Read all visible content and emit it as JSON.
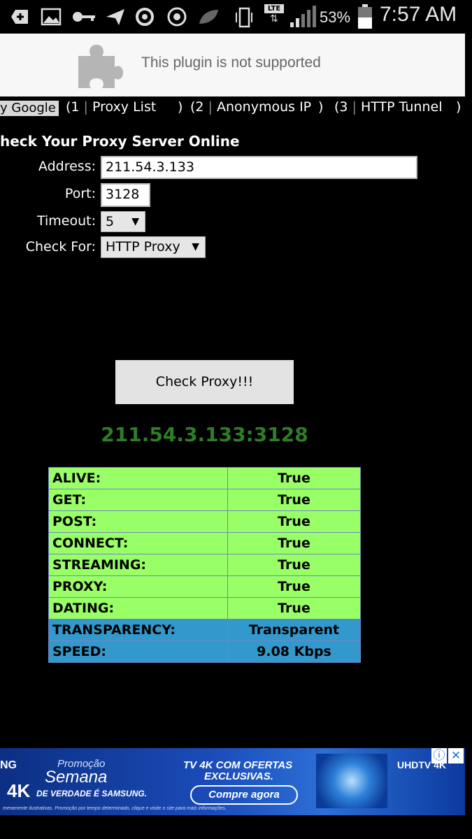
{
  "status_bar": {
    "icons": [
      "add-icon",
      "image-icon",
      "key-icon",
      "send-icon",
      "sync-icon",
      "chrome-icon",
      "leaf-icon",
      "vibrate-icon",
      "lte-icon",
      "signal-icon",
      "battery-icon"
    ],
    "network": "LTE",
    "battery": "53%",
    "time": "7:57 AM"
  },
  "plugin": {
    "message": "This plugin is not supported"
  },
  "tabs": {
    "google": "y Google",
    "items": [
      {
        "num": "1",
        "label": "Proxy List"
      },
      {
        "num": "2",
        "label": "Anonymous IP"
      },
      {
        "num": "3",
        "label": "HTTP Tunnel"
      }
    ]
  },
  "form": {
    "title": "heck Your Proxy Server Online",
    "address_label": "Address:",
    "address_value": "211.54.3.133",
    "port_label": "Port:",
    "port_value": "3128",
    "timeout_label": "Timeout:",
    "timeout_value": "5",
    "checkfor_label": "Check For:",
    "checkfor_value": "HTTP Proxy",
    "button": "Check Proxy!!!"
  },
  "result": {
    "ip": "211.54.3.133:3128",
    "rows": [
      {
        "key": "ALIVE:",
        "value": "True",
        "color": "#99ff66"
      },
      {
        "key": "GET:",
        "value": "True",
        "color": "#99ff66"
      },
      {
        "key": "POST:",
        "value": "True",
        "color": "#99ff66"
      },
      {
        "key": "CONNECT:",
        "value": "True",
        "color": "#99ff66"
      },
      {
        "key": "STREAMING:",
        "value": "True",
        "color": "#99ff66"
      },
      {
        "key": "PROXY:",
        "value": "True",
        "color": "#99ff66"
      },
      {
        "key": "DATING:",
        "value": "True",
        "color": "#99ff66"
      },
      {
        "key": "TRANSPARENCY:",
        "value": "Transparent",
        "color": "#3399cc"
      },
      {
        "key": "SPEED:",
        "value": "9.08 Kbps",
        "color": "#3399cc"
      }
    ]
  },
  "ad": {
    "brand_fragment": "NG",
    "promo": "Promoção",
    "semana": "Semana",
    "res": "4K",
    "de_verdade": "DE VERDADE É SAMSUNG.",
    "headline1": "TV 4K COM OFERTAS",
    "headline2": "EXCLUSIVAS.",
    "cta": "Compre agora",
    "uhd": "UHDTV 4K",
    "disclaimer": "meramente ilustrativas. Promoção por tempo determinado, clique e visite o site para mais informações."
  }
}
